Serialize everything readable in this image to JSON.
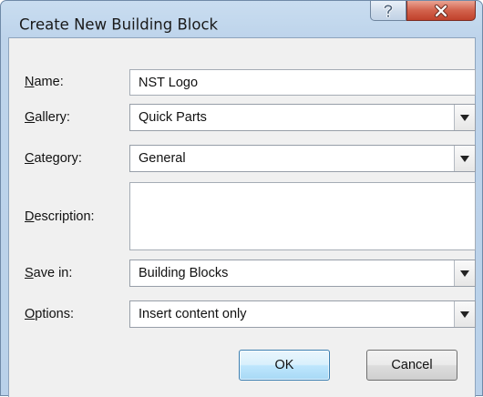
{
  "window": {
    "title": "Create New Building Block",
    "help_icon": "question-mark-icon",
    "close_icon": "close-x-icon"
  },
  "form": {
    "name": {
      "label_hotkey": "N",
      "label_rest": "ame:",
      "value": "NST Logo"
    },
    "gallery": {
      "label_hotkey": "G",
      "label_rest": "allery:",
      "value": "Quick Parts"
    },
    "category": {
      "label_hotkey": "C",
      "label_rest": "ategory:",
      "value": "General"
    },
    "description": {
      "label_hotkey": "D",
      "label_rest": "escription:",
      "value": ""
    },
    "save_in": {
      "label_hotkey": "S",
      "label_rest": "ave in:",
      "value": "Building Blocks"
    },
    "options": {
      "label_hotkey": "O",
      "label_rest": "ptions:",
      "value": "Insert content only"
    }
  },
  "buttons": {
    "ok": "OK",
    "cancel": "Cancel"
  }
}
